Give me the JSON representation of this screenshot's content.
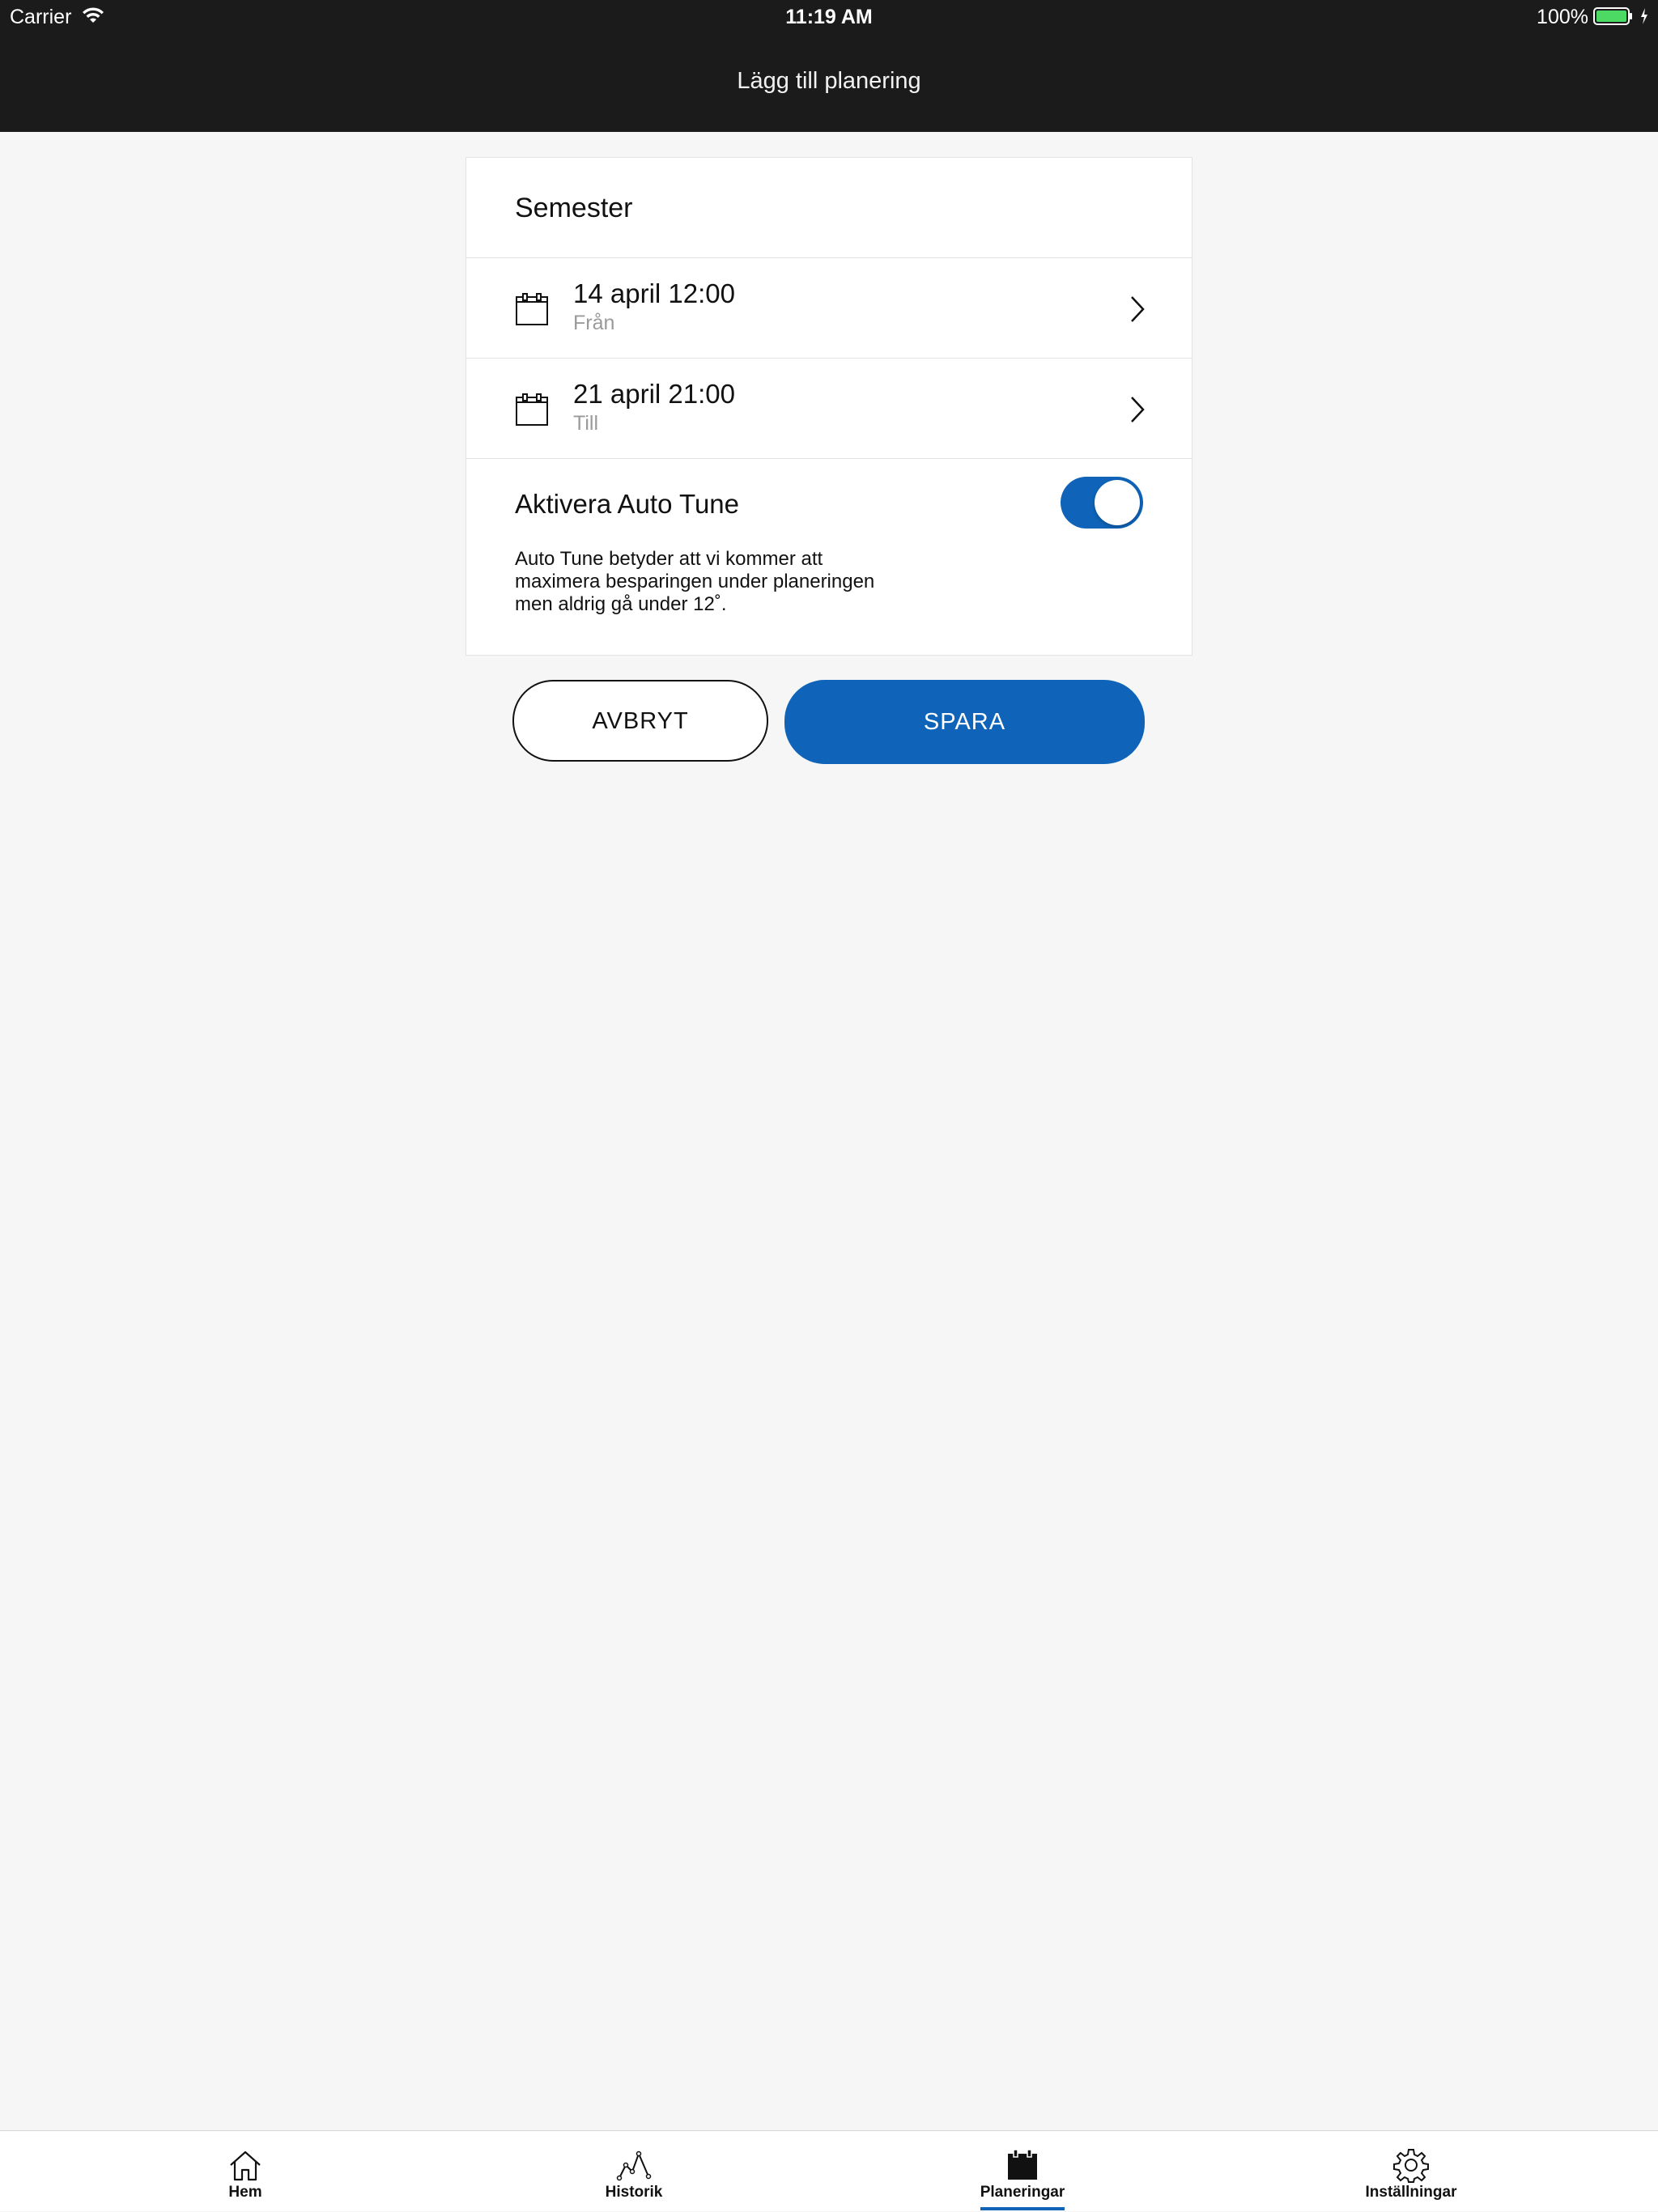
{
  "status_bar": {
    "carrier": "Carrier",
    "time": "11:19 AM",
    "battery": "100%"
  },
  "nav": {
    "title": "Lägg till planering"
  },
  "form": {
    "name": "Semester",
    "from": {
      "value": "14 april 12:00",
      "label": "Från"
    },
    "to": {
      "value": "21 april 21:00",
      "label": "Till"
    },
    "autotune": {
      "label": "Aktivera Auto Tune",
      "enabled": true,
      "description": "Auto Tune betyder att vi kommer att maximera besparingen under planeringen men aldrig gå under 12˚."
    }
  },
  "actions": {
    "cancel_label": "AVBRYT",
    "save_label": "SPARA"
  },
  "tabbar": {
    "items": [
      {
        "label": "Hem",
        "icon": "home-icon",
        "active": false
      },
      {
        "label": "Historik",
        "icon": "history-graph-icon",
        "active": false
      },
      {
        "label": "Planeringar",
        "icon": "calendar-icon",
        "active": true
      },
      {
        "label": "Inställningar",
        "icon": "gear-icon",
        "active": false
      }
    ]
  },
  "colors": {
    "accent": "#0f64b9",
    "header_bg": "#1b1b1b",
    "page_bg": "#f6f6f6",
    "battery": "#4cd964"
  }
}
